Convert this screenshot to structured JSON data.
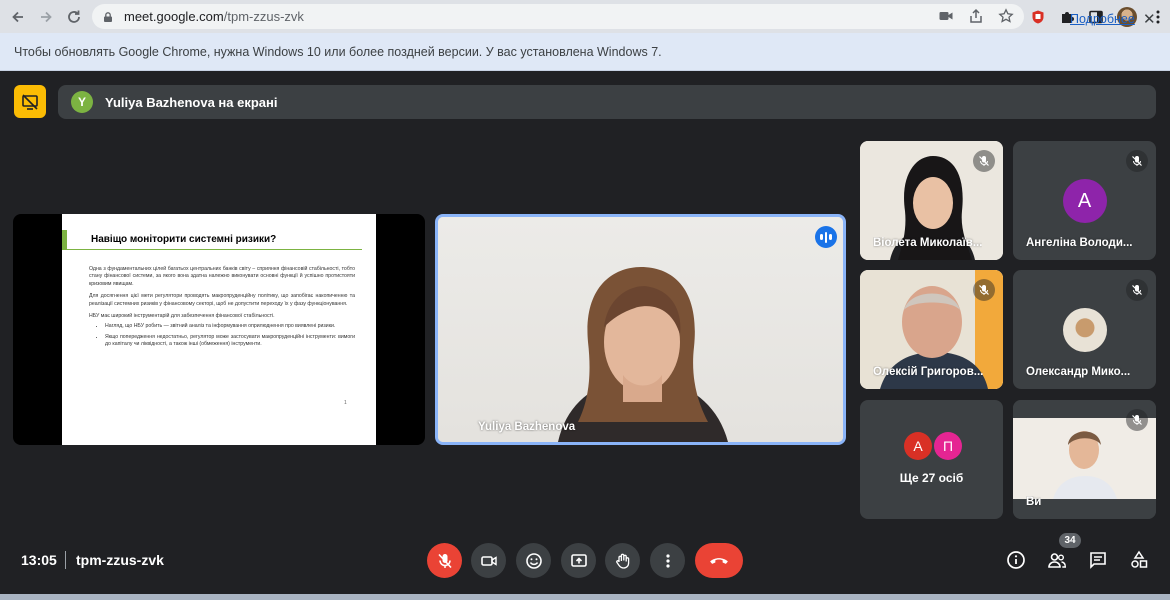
{
  "browser": {
    "url_host": "meet.google.com",
    "url_path": "/tpm-zzus-zvk"
  },
  "info_bar": {
    "message": "Чтобы обновлять Google Chrome, нужна Windows 10 или более поздней версии. У вас установлена Windows 7.",
    "link": "Подробнее",
    "close": "✕"
  },
  "meet": {
    "presenting_avatar_letter": "Y",
    "presenting_text": "Yuliya Bazhenova на екрані",
    "slide": {
      "title": "Навіщо моніторити системні ризики?",
      "para1": "Одна з фундаментальних цілей багатьох центральних банків світу – сприяння фінансовій стабільності, тобто стану фінансової системи, за якого вона здатна належно виконувати основні функції й успішно протистояти кризовим явищам.",
      "para2": "Для досягнення цієї мети регулятори проводять макропруденційну політику, що запобігає накопиченню та реалізації системних ризиків у фінансовому секторі, щоб не допустити переходу їх у фазу функціонування.",
      "para3": "НБУ має широкий інструментарій для забезпечення фінансової стабільності.",
      "bullet1": "Нагляд, що НБУ робить — звітний аналіз та інформування оприлюднення про виявлені ризики.",
      "bullet2": "Якщо попередження недостатньо, регулятор може застосувати макропруденційні інструменти: вимоги до капіталу чи ліквідності, а також інші (обмеження) інструменти.",
      "page_mark": "1"
    },
    "speaker": {
      "name": "Yuliya Bazhenova"
    },
    "participants": [
      {
        "name": "Віолета Миколаїв..."
      },
      {
        "name": "Ангеліна Володи...",
        "avatar_letter": "A",
        "avatar_color": "#8e24aa"
      },
      {
        "name": "Олексій Григоров..."
      },
      {
        "name": "Олександр Мико..."
      },
      {
        "more_label": "Ще 27 осіб",
        "avatar1": "А",
        "avatar1_color": "#d93025",
        "avatar2": "П",
        "avatar2_color": "#e52592"
      },
      {
        "name": "Ви"
      }
    ],
    "meeting_time": "13:05",
    "meeting_code": "tpm-zzus-zvk",
    "people_count": "34"
  },
  "colors": {
    "accent_blue": "#8ab4f8",
    "hangup_red": "#ea4335",
    "present_yellow": "#fbbc04"
  }
}
